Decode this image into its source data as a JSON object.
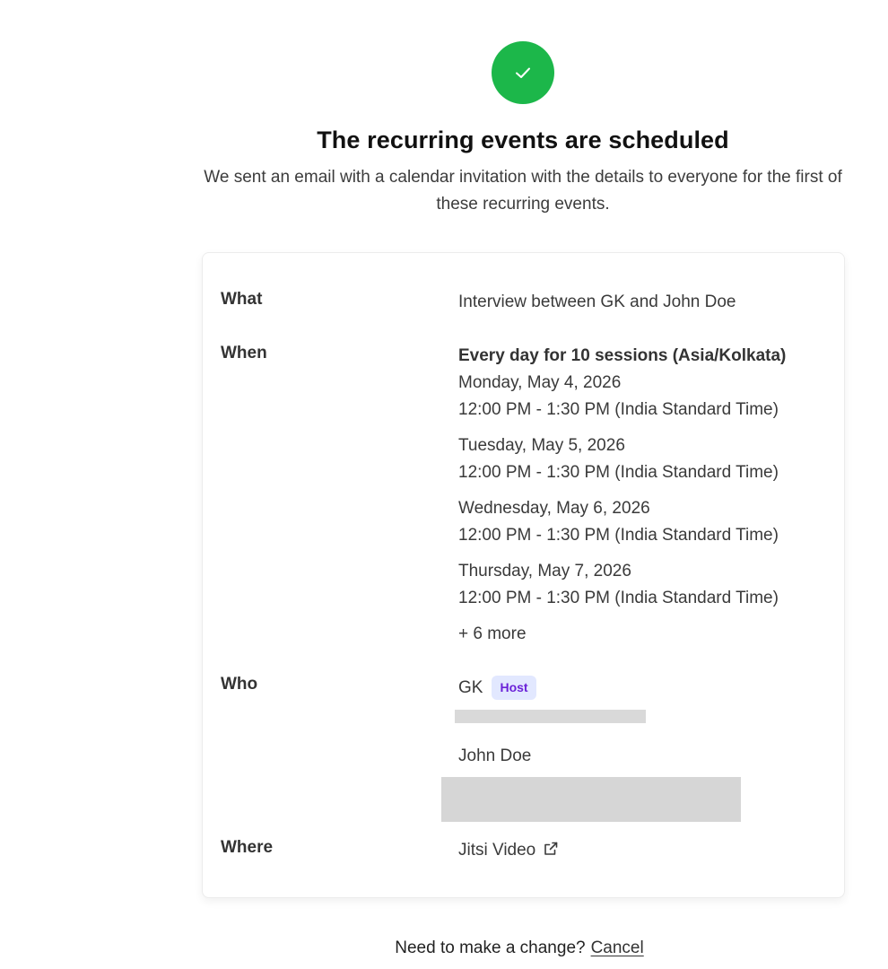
{
  "status": {
    "title": "The recurring events are scheduled",
    "subtitle": "We sent an email with a calendar invitation with the details to everyone for the first of these recurring events."
  },
  "details": {
    "what": {
      "label": "What",
      "value": "Interview between GK and John Doe"
    },
    "when": {
      "label": "When",
      "recurrence": "Every day for 10 sessions (Asia/Kolkata)",
      "occurrences": [
        {
          "date": "Monday, May 4, 2026",
          "time": "12:00 PM - 1:30 PM (India Standard Time)"
        },
        {
          "date": "Tuesday, May 5, 2026",
          "time": "12:00 PM - 1:30 PM (India Standard Time)"
        },
        {
          "date": "Wednesday, May 6, 2026",
          "time": "12:00 PM - 1:30 PM (India Standard Time)"
        },
        {
          "date": "Thursday, May 7, 2026",
          "time": "12:00 PM - 1:30 PM (India Standard Time)"
        }
      ],
      "more": "+ 6 more"
    },
    "who": {
      "label": "Who",
      "attendees": [
        {
          "name": "GK",
          "badge": "Host"
        },
        {
          "name": "John Doe"
        }
      ]
    },
    "where": {
      "label": "Where",
      "value": "Jitsi Video"
    }
  },
  "footer": {
    "prompt": "Need to make a change?",
    "cancel_label": "Cancel"
  },
  "colors": {
    "success": "#1cb74a",
    "host_badge_bg": "#e2e8ff",
    "host_badge_text": "#6b22d8"
  }
}
